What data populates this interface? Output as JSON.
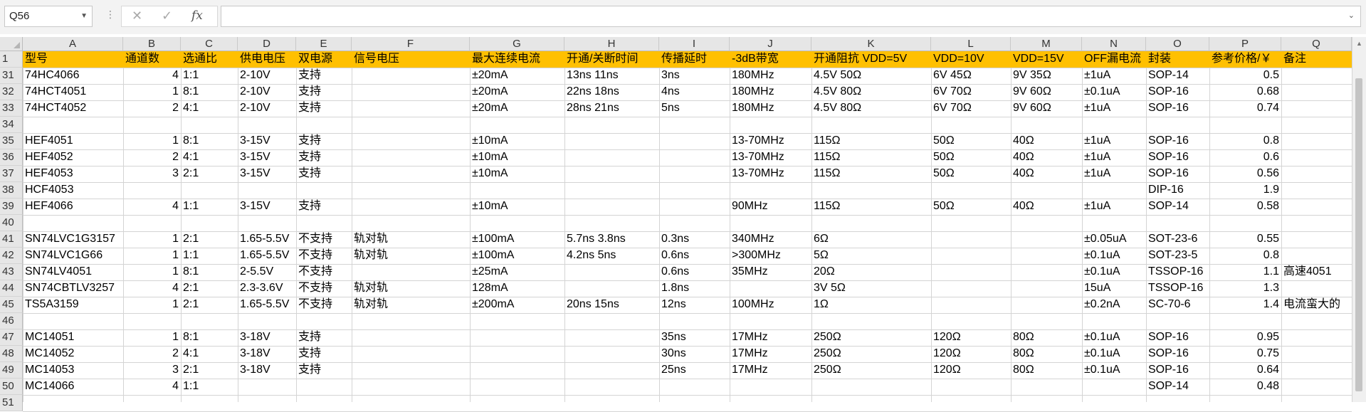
{
  "formula_bar": {
    "name_box": "Q56",
    "cancel_icon": "✕",
    "enter_icon": "✓",
    "fx_label": "fx",
    "formula": ""
  },
  "columns": [
    "A",
    "B",
    "C",
    "D",
    "E",
    "F",
    "G",
    "H",
    "I",
    "J",
    "K",
    "L",
    "M",
    "N",
    "O",
    "P",
    "Q"
  ],
  "header_row": {
    "row_number": "1",
    "cells": [
      "型号",
      "通道数",
      "选通比",
      "供电电压",
      "双电源",
      "信号电压",
      "最大连续电流",
      "开通/关断时间",
      "传播延时",
      "-3dB带宽",
      "开通阻抗 VDD=5V",
      "VDD=10V",
      "VDD=15V",
      "OFF漏电流",
      "封装",
      "参考价格/￥",
      "备注"
    ]
  },
  "rows": [
    {
      "n": "31",
      "c": [
        "74HC4066",
        "4",
        "1:1",
        "2-10V",
        "支持",
        "",
        "±20mA",
        "13ns    11ns",
        "3ns",
        "180MHz",
        "4.5V    50Ω",
        "6V    45Ω",
        "9V    35Ω",
        "±1uA",
        "SOP-14",
        "0.5",
        ""
      ]
    },
    {
      "n": "32",
      "c": [
        "74HCT4051",
        "1",
        "8:1",
        "2-10V",
        "支持",
        "",
        "±20mA",
        "22ns    18ns",
        "4ns",
        "180MHz",
        "4.5V    80Ω",
        "6V    70Ω",
        "9V    60Ω",
        "±0.1uA",
        "SOP-16",
        "0.68",
        ""
      ]
    },
    {
      "n": "33",
      "c": [
        "74HCT4052",
        "2",
        "4:1",
        "2-10V",
        "支持",
        "",
        "±20mA",
        "28ns    21ns",
        "5ns",
        "180MHz",
        "4.5V    80Ω",
        "6V    70Ω",
        "9V    60Ω",
        "±1uA",
        "SOP-16",
        "0.74",
        ""
      ]
    },
    {
      "n": "34",
      "c": [
        "",
        "",
        "",
        "",
        "",
        "",
        "",
        "",
        "",
        "",
        "",
        "",
        "",
        "",
        "",
        "",
        ""
      ]
    },
    {
      "n": "35",
      "c": [
        "HEF4051",
        "1",
        "8:1",
        "3-15V",
        "支持",
        "",
        "±10mA",
        "",
        "",
        "13-70MHz",
        "115Ω",
        "50Ω",
        "40Ω",
        "±1uA",
        "SOP-16",
        "0.8",
        ""
      ]
    },
    {
      "n": "36",
      "c": [
        "HEF4052",
        "2",
        "4:1",
        "3-15V",
        "支持",
        "",
        "±10mA",
        "",
        "",
        "13-70MHz",
        "115Ω",
        "50Ω",
        "40Ω",
        "±1uA",
        "SOP-16",
        "0.6",
        ""
      ]
    },
    {
      "n": "37",
      "c": [
        "HEF4053",
        "3",
        "2:1",
        "3-15V",
        "支持",
        "",
        "±10mA",
        "",
        "",
        "13-70MHz",
        "115Ω",
        "50Ω",
        "40Ω",
        "±1uA",
        "SOP-16",
        "0.56",
        ""
      ]
    },
    {
      "n": "38",
      "c": [
        "HCF4053",
        "",
        "",
        "",
        "",
        "",
        "",
        "",
        "",
        "",
        "",
        "",
        "",
        "",
        "DIP-16",
        "1.9",
        ""
      ]
    },
    {
      "n": "39",
      "c": [
        "HEF4066",
        "4",
        "1:1",
        "3-15V",
        "支持",
        "",
        "±10mA",
        "",
        "",
        "90MHz",
        "115Ω",
        "50Ω",
        "40Ω",
        "±1uA",
        "SOP-14",
        "0.58",
        ""
      ]
    },
    {
      "n": "40",
      "c": [
        "",
        "",
        "",
        "",
        "",
        "",
        "",
        "",
        "",
        "",
        "",
        "",
        "",
        "",
        "",
        "",
        ""
      ]
    },
    {
      "n": "41",
      "c": [
        "SN74LVC1G3157",
        "1",
        "2:1",
        "1.65-5.5V",
        "不支持",
        "轨对轨",
        "±100mA",
        "5.7ns    3.8ns",
        "0.3ns",
        "340MHz",
        "6Ω",
        "",
        "",
        "±0.05uA",
        "SOT-23-6",
        "0.55",
        ""
      ]
    },
    {
      "n": "42",
      "c": [
        "SN74LVC1G66",
        "1",
        "1:1",
        "1.65-5.5V",
        "不支持",
        "轨对轨",
        "±100mA",
        "4.2ns    5ns",
        "0.6ns",
        ">300MHz",
        "5Ω",
        "",
        "",
        "±0.1uA",
        "SOT-23-5",
        "0.8",
        ""
      ]
    },
    {
      "n": "43",
      "c": [
        "SN74LV4051",
        "1",
        "8:1",
        "2-5.5V",
        "不支持",
        "",
        "±25mA",
        "",
        "0.6ns",
        "35MHz",
        "20Ω",
        "",
        "",
        "±0.1uA",
        "TSSOP-16",
        "1.1",
        "高速4051"
      ]
    },
    {
      "n": "44",
      "c": [
        "SN74CBTLV3257",
        "4",
        "2:1",
        "2.3-3.6V",
        "不支持",
        "轨对轨",
        "128mA",
        "",
        "1.8ns",
        "",
        "3V    5Ω",
        "",
        "",
        "15uA",
        "TSSOP-16",
        "1.3",
        ""
      ]
    },
    {
      "n": "45",
      "c": [
        "TS5A3159",
        "1",
        "2:1",
        "1.65-5.5V",
        "不支持",
        "轨对轨",
        "±200mA",
        "20ns    15ns",
        "12ns",
        "100MHz",
        "1Ω",
        "",
        "",
        "±0.2nA",
        "SC-70-6",
        "1.4",
        "电流蛮大的"
      ]
    },
    {
      "n": "46",
      "c": [
        "",
        "",
        "",
        "",
        "",
        "",
        "",
        "",
        "",
        "",
        "",
        "",
        "",
        "",
        "",
        "",
        ""
      ]
    },
    {
      "n": "47",
      "c": [
        "MC14051",
        "1",
        "8:1",
        "3-18V",
        "支持",
        "",
        "",
        "",
        "35ns",
        "17MHz",
        "250Ω",
        "120Ω",
        "80Ω",
        "±0.1uA",
        "SOP-16",
        "0.95",
        ""
      ]
    },
    {
      "n": "48",
      "c": [
        "MC14052",
        "2",
        "4:1",
        "3-18V",
        "支持",
        "",
        "",
        "",
        "30ns",
        "17MHz",
        "250Ω",
        "120Ω",
        "80Ω",
        "±0.1uA",
        "SOP-16",
        "0.75",
        ""
      ]
    },
    {
      "n": "49",
      "c": [
        "MC14053",
        "3",
        "2:1",
        "3-18V",
        "支持",
        "",
        "",
        "",
        "25ns",
        "17MHz",
        "250Ω",
        "120Ω",
        "80Ω",
        "±0.1uA",
        "SOP-16",
        "0.64",
        ""
      ]
    },
    {
      "n": "50",
      "c": [
        "MC14066",
        "4",
        "1:1",
        "",
        "",
        "",
        "",
        "",
        "",
        "",
        "",
        "",
        "",
        "",
        "SOP-14",
        "0.48",
        ""
      ]
    },
    {
      "n": "51",
      "c": [
        "",
        "",
        "",
        "",
        "",
        "",
        "",
        "",
        "",
        "",
        "",
        "",
        "",
        "",
        "",
        "",
        ""
      ]
    }
  ],
  "colors": {
    "header_fill": "#ffc000",
    "gridline": "#d4d4d4",
    "headers_bg": "#e6e6e6"
  }
}
